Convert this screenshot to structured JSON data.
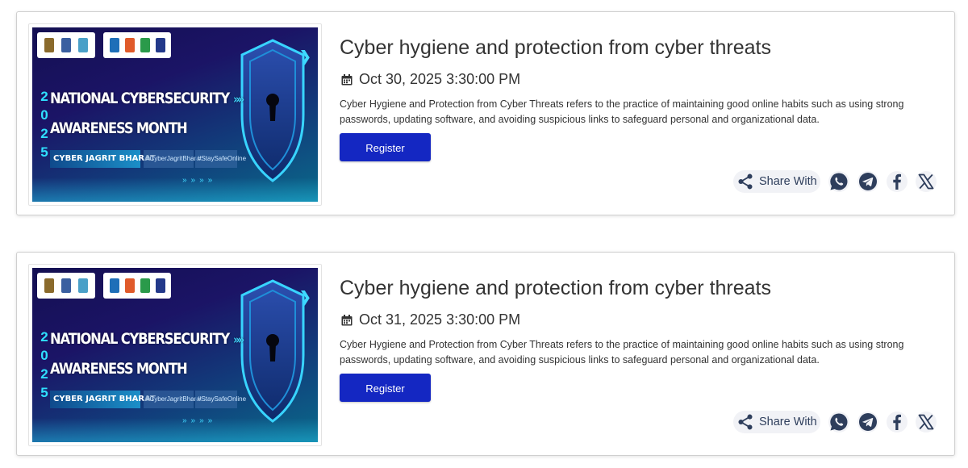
{
  "colors": {
    "register_button": "#1427c2",
    "share_icon": "#2e3e5c",
    "banner_background": "#140f52",
    "banner_accent": "#2fe0ff"
  },
  "events": [
    {
      "banner": {
        "year_digits": [
          "2",
          "0",
          "2",
          "5"
        ],
        "title_line1": "NATIONAL CYBERSECURITY",
        "title_line2": "AWARENESS MONTH",
        "title_arrows": "»»",
        "tag": "CYBER JAGRIT BHARAT",
        "hashtag1": "#CyberJagritBharat",
        "hashtag2": "#StaySafeOnline"
      },
      "title": "Cyber hygiene and protection from cyber threats",
      "date": "Oct 30, 2025 3:30:00 PM",
      "description": "Cyber Hygiene and Protection from Cyber Threats refers to the practice of maintaining good online habits such as using strong passwords, updating software, and avoiding suspicious links to safeguard personal and organizational data.",
      "register_label": "Register",
      "share_label": "Share With",
      "icons": [
        "calendar-icon",
        "share-icon",
        "whatsapp-icon",
        "telegram-icon",
        "facebook-icon",
        "x-icon"
      ]
    },
    {
      "banner": {
        "year_digits": [
          "2",
          "0",
          "2",
          "5"
        ],
        "title_line1": "NATIONAL CYBERSECURITY",
        "title_line2": "AWARENESS MONTH",
        "title_arrows": "»»",
        "tag": "CYBER JAGRIT BHARAT",
        "hashtag1": "#CyberJagritBharat",
        "hashtag2": "#StaySafeOnline"
      },
      "title": "Cyber hygiene and protection from cyber threats",
      "date": "Oct 31, 2025 3:30:00 PM",
      "description": "Cyber Hygiene and Protection from Cyber Threats refers to the practice of maintaining good online habits such as using strong passwords, updating software, and avoiding suspicious links to safeguard personal and organizational data.",
      "register_label": "Register",
      "share_label": "Share With",
      "icons": [
        "calendar-icon",
        "share-icon",
        "whatsapp-icon",
        "telegram-icon",
        "facebook-icon",
        "x-icon"
      ]
    }
  ]
}
